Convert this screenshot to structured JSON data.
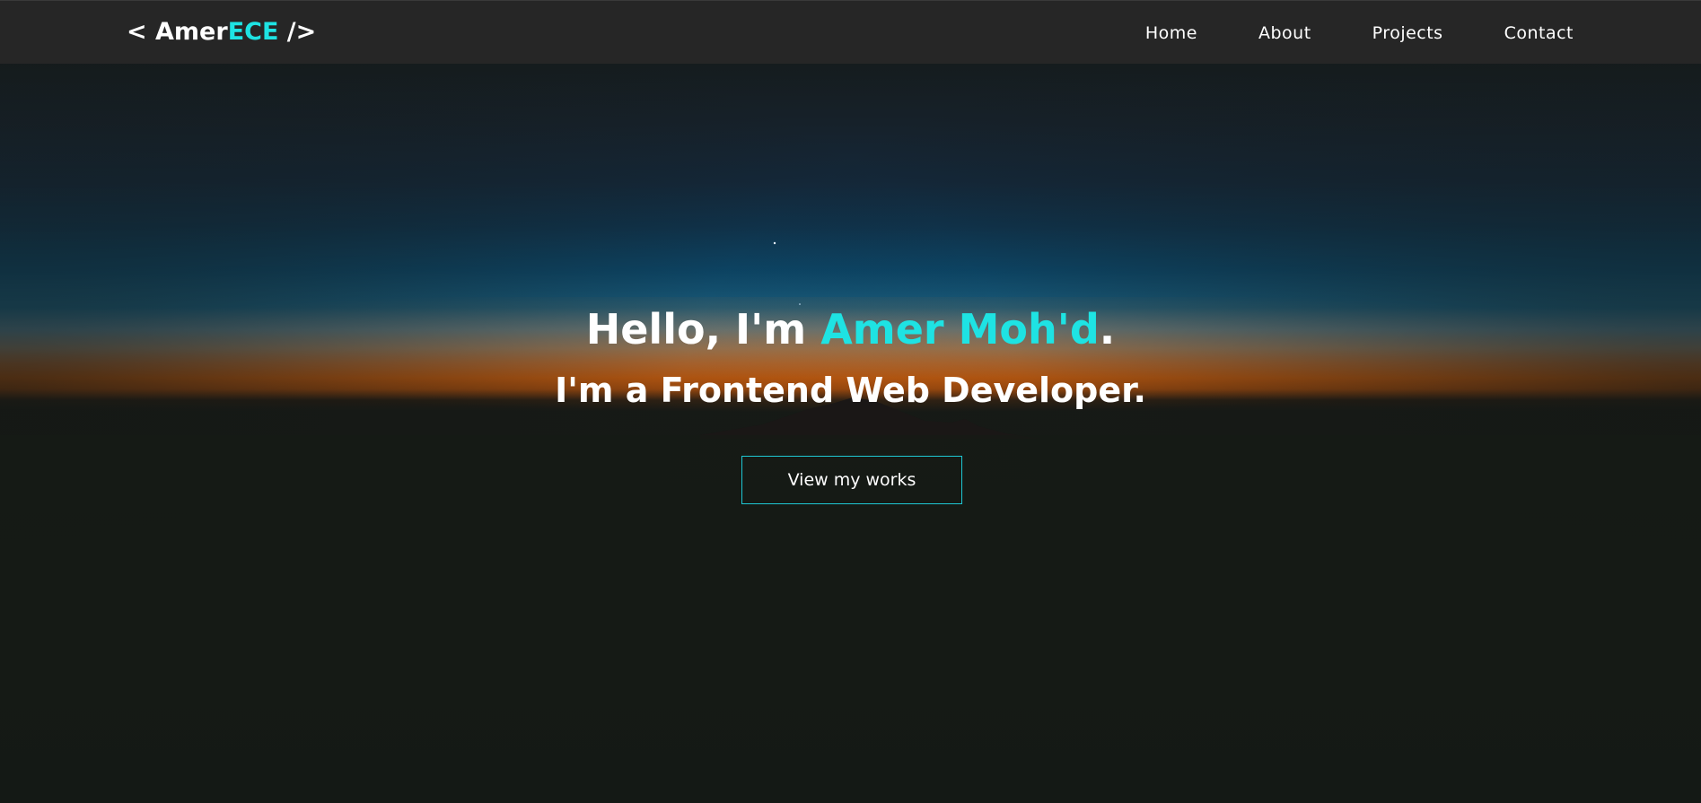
{
  "navbar": {
    "logo_open": "< ",
    "logo_main": "Amer",
    "logo_accent": "ECE",
    "logo_close": " />",
    "links": [
      {
        "label": "Home"
      },
      {
        "label": "About"
      },
      {
        "label": "Projects"
      },
      {
        "label": "Contact"
      }
    ]
  },
  "hero": {
    "greeting": "Hello, I'm ",
    "name": "Amer Moh'd",
    "greeting_end": ".",
    "subtitle": "I'm a Frontend Web Developer.",
    "cta_label": "View my works"
  },
  "colors": {
    "accent": "#1ee3e3",
    "navbar_bg": "#262626",
    "page_bg": "#141815",
    "text": "#ffffff"
  }
}
